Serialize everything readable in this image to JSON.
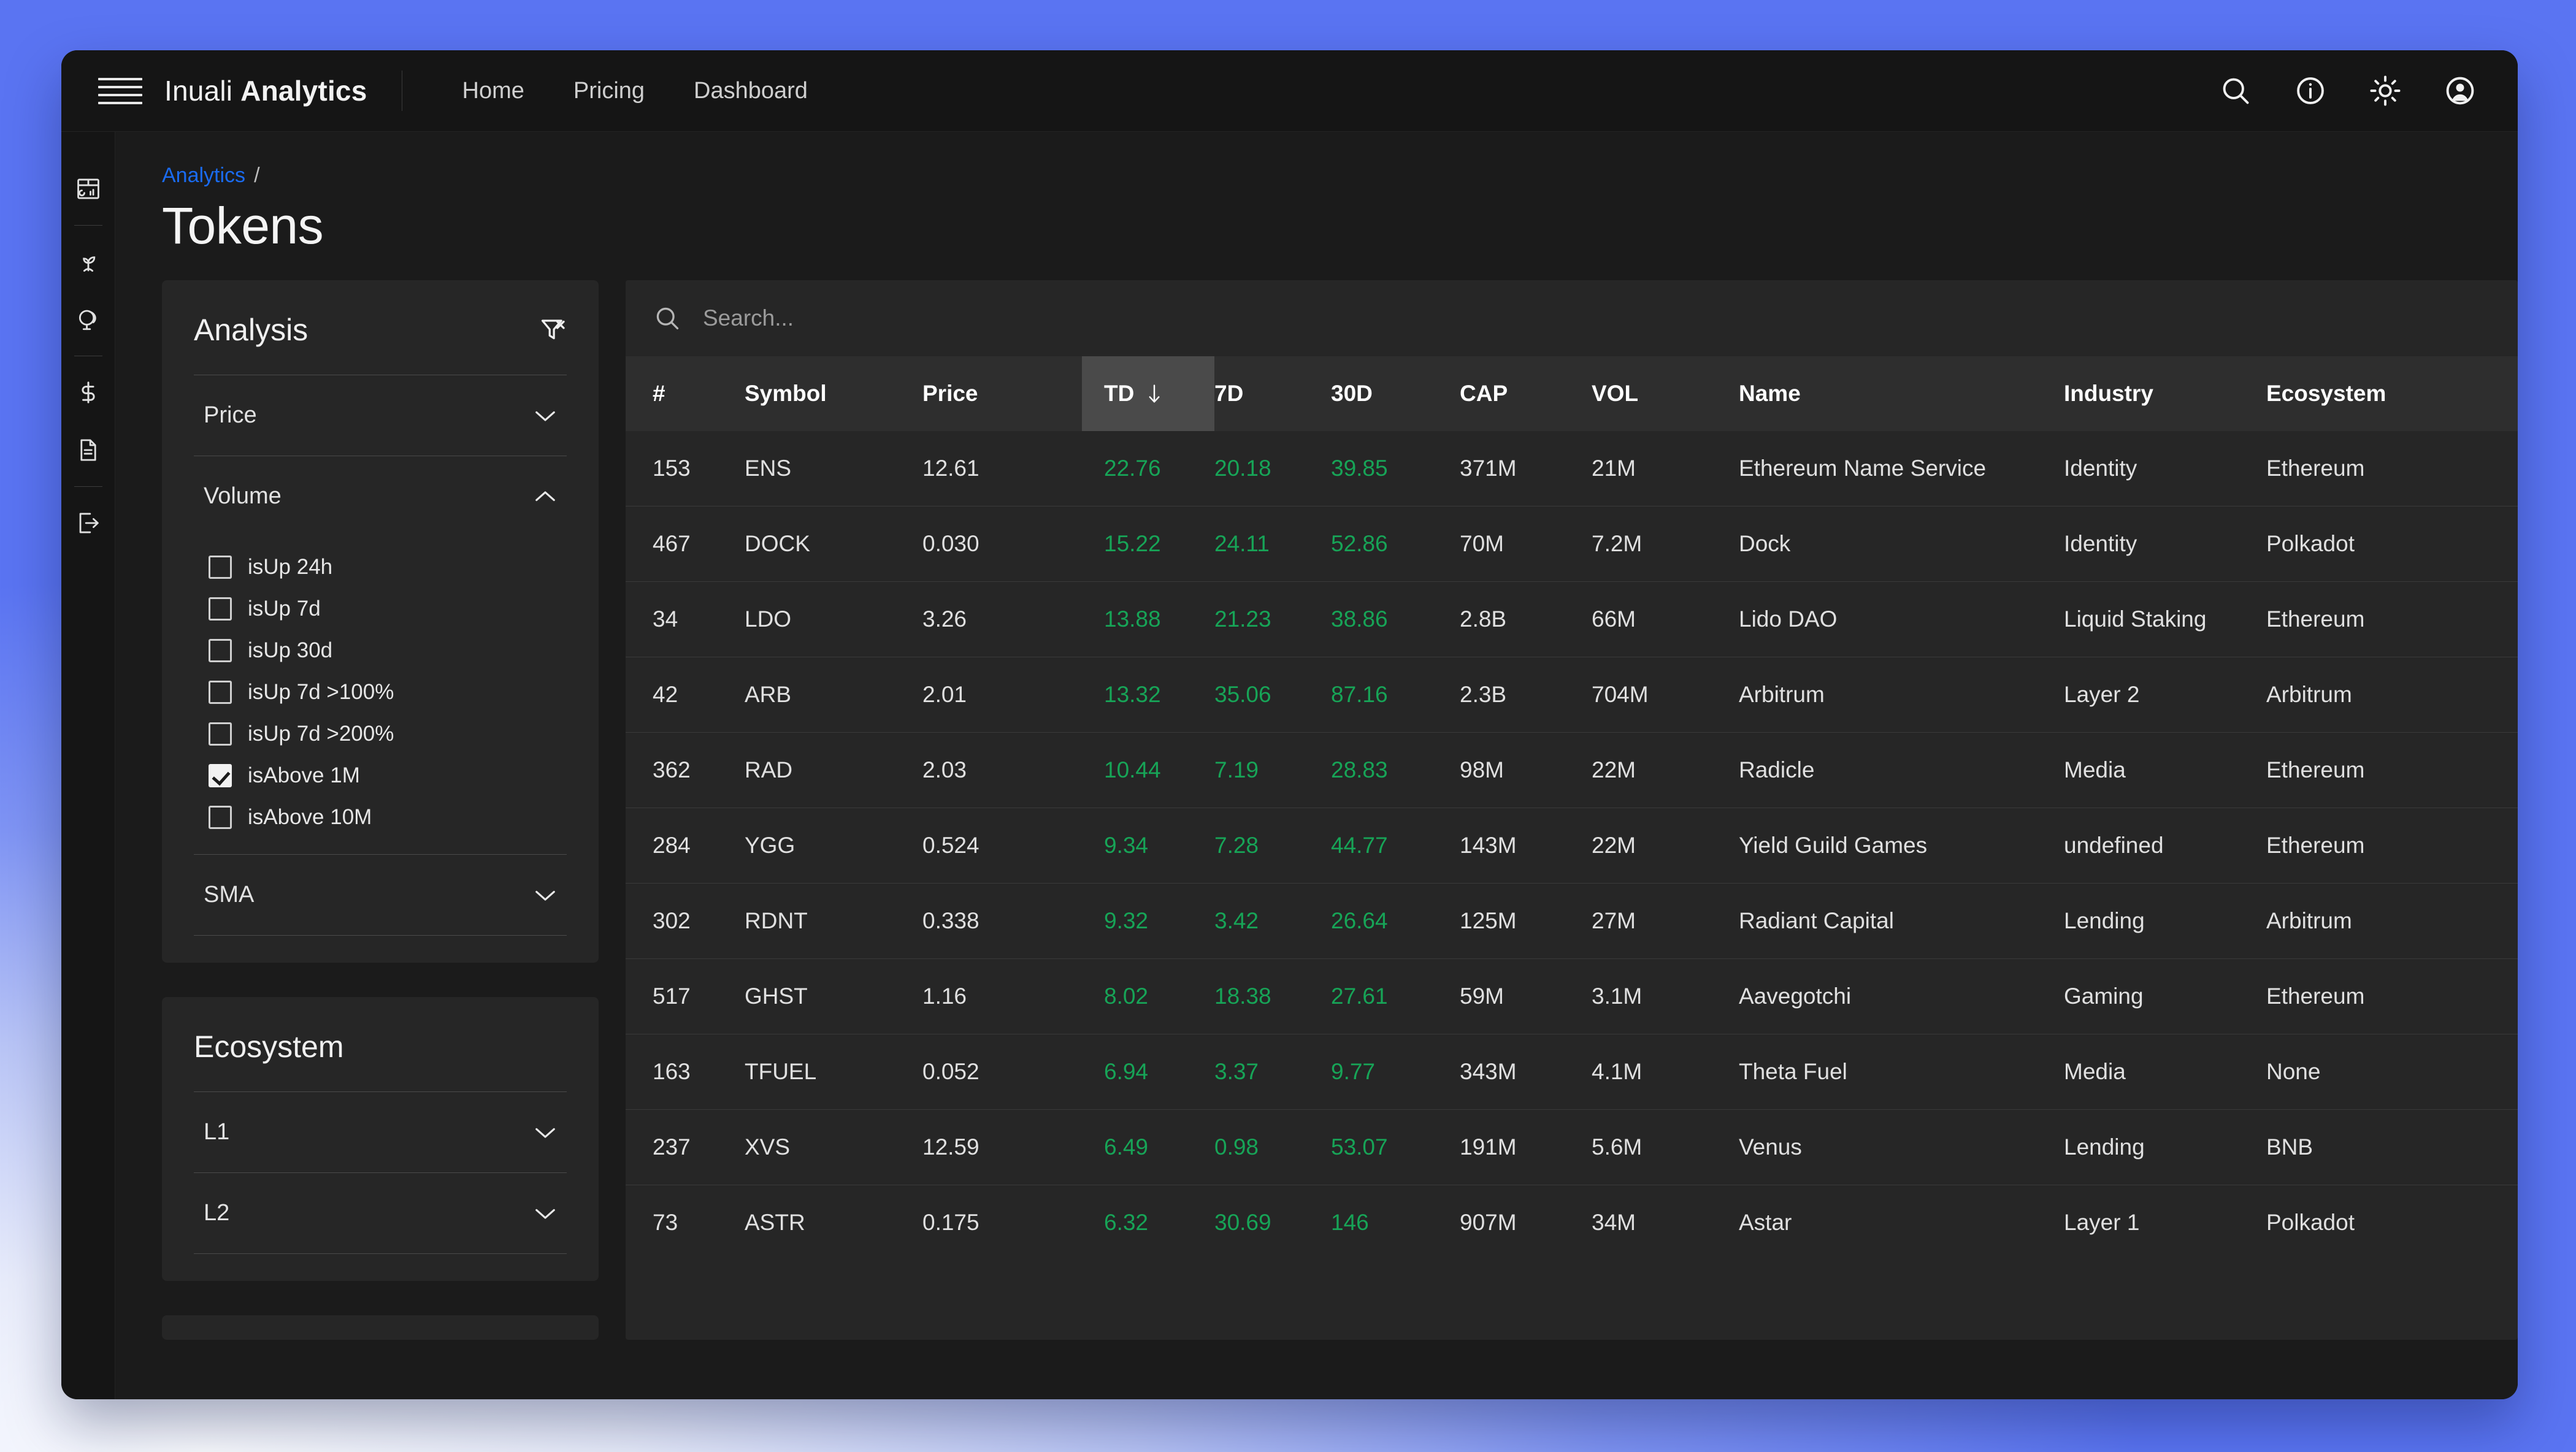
{
  "app": {
    "brand_prefix": "Inuali ",
    "brand_bold": "Analytics"
  },
  "nav": {
    "items": [
      {
        "label": "Home"
      },
      {
        "label": "Pricing"
      },
      {
        "label": "Dashboard"
      }
    ]
  },
  "topbar_icons": [
    {
      "name": "search-icon"
    },
    {
      "name": "info-icon"
    },
    {
      "name": "brightness-icon"
    },
    {
      "name": "account-icon"
    }
  ],
  "rail": {
    "items": [
      {
        "name": "dashboard-icon"
      },
      {
        "name": "sprout-icon"
      },
      {
        "name": "globe-icon"
      },
      {
        "name": "dollar-icon"
      },
      {
        "name": "document-icon"
      },
      {
        "name": "logout-icon"
      }
    ]
  },
  "breadcrumb": {
    "parent": "Analytics",
    "separator": "/"
  },
  "page": {
    "title": "Tokens"
  },
  "analysis_panel": {
    "title": "Analysis",
    "clear_filter_icon": "filter-off-icon",
    "sections": [
      {
        "label": "Price",
        "expanded": false
      },
      {
        "label": "Volume",
        "expanded": true
      },
      {
        "label": "SMA",
        "expanded": false
      }
    ],
    "volume_options": [
      {
        "label": "isUp 24h",
        "checked": false
      },
      {
        "label": "isUp 7d",
        "checked": false
      },
      {
        "label": "isUp 30d",
        "checked": false
      },
      {
        "label": "isUp 7d >100%",
        "checked": false
      },
      {
        "label": "isUp 7d >200%",
        "checked": false
      },
      {
        "label": "isAbove 1M",
        "checked": true
      },
      {
        "label": "isAbove 10M",
        "checked": false
      }
    ]
  },
  "ecosystem_panel": {
    "title": "Ecosystem",
    "sections": [
      {
        "label": "L1",
        "expanded": false
      },
      {
        "label": "L2",
        "expanded": false
      }
    ]
  },
  "search": {
    "placeholder": "Search...",
    "value": "",
    "icon": "search-icon"
  },
  "table": {
    "sort_column": "TD",
    "sort_direction": "desc",
    "columns": [
      {
        "key": "rank",
        "label": "#",
        "cls": "c-rank",
        "sorted": false
      },
      {
        "key": "symbol",
        "label": "Symbol",
        "cls": "c-symbol",
        "sorted": false
      },
      {
        "key": "price",
        "label": "Price",
        "cls": "c-price",
        "sorted": false
      },
      {
        "key": "td",
        "label": "TD",
        "cls": "c-td",
        "sorted": true
      },
      {
        "key": "d7",
        "label": "7D",
        "cls": "c-7d",
        "sorted": false
      },
      {
        "key": "d30",
        "label": "30D",
        "cls": "c-30d",
        "sorted": false
      },
      {
        "key": "cap",
        "label": "CAP",
        "cls": "c-cap",
        "sorted": false
      },
      {
        "key": "vol",
        "label": "VOL",
        "cls": "c-vol",
        "sorted": false
      },
      {
        "key": "name",
        "label": "Name",
        "cls": "c-name",
        "sorted": false
      },
      {
        "key": "industry",
        "label": "Industry",
        "cls": "c-ind",
        "sorted": false
      },
      {
        "key": "ecosystem",
        "label": "Ecosystem",
        "cls": "c-eco",
        "sorted": false
      }
    ],
    "rows": [
      {
        "rank": "153",
        "symbol": "ENS",
        "price": "12.61",
        "td": "22.76",
        "d7": "20.18",
        "d30": "39.85",
        "cap": "371M",
        "vol": "21M",
        "name": "Ethereum Name Service",
        "industry": "Identity",
        "ecosystem": "Ethereum"
      },
      {
        "rank": "467",
        "symbol": "DOCK",
        "price": "0.030",
        "td": "15.22",
        "d7": "24.11",
        "d30": "52.86",
        "cap": "70M",
        "vol": "7.2M",
        "name": "Dock",
        "industry": "Identity",
        "ecosystem": "Polkadot"
      },
      {
        "rank": "34",
        "symbol": "LDO",
        "price": "3.26",
        "td": "13.88",
        "d7": "21.23",
        "d30": "38.86",
        "cap": "2.8B",
        "vol": "66M",
        "name": "Lido DAO",
        "industry": "Liquid Staking",
        "ecosystem": "Ethereum"
      },
      {
        "rank": "42",
        "symbol": "ARB",
        "price": "2.01",
        "td": "13.32",
        "d7": "35.06",
        "d30": "87.16",
        "cap": "2.3B",
        "vol": "704M",
        "name": "Arbitrum",
        "industry": "Layer 2",
        "ecosystem": "Arbitrum"
      },
      {
        "rank": "362",
        "symbol": "RAD",
        "price": "2.03",
        "td": "10.44",
        "d7": "7.19",
        "d30": "28.83",
        "cap": "98M",
        "vol": "22M",
        "name": "Radicle",
        "industry": "Media",
        "ecosystem": "Ethereum"
      },
      {
        "rank": "284",
        "symbol": "YGG",
        "price": "0.524",
        "td": "9.34",
        "d7": "7.28",
        "d30": "44.77",
        "cap": "143M",
        "vol": "22M",
        "name": "Yield Guild Games",
        "industry": "undefined",
        "ecosystem": "Ethereum"
      },
      {
        "rank": "302",
        "symbol": "RDNT",
        "price": "0.338",
        "td": "9.32",
        "d7": "3.42",
        "d30": "26.64",
        "cap": "125M",
        "vol": "27M",
        "name": "Radiant Capital",
        "industry": "Lending",
        "ecosystem": "Arbitrum"
      },
      {
        "rank": "517",
        "symbol": "GHST",
        "price": "1.16",
        "td": "8.02",
        "d7": "18.38",
        "d30": "27.61",
        "cap": "59M",
        "vol": "3.1M",
        "name": "Aavegotchi",
        "industry": "Gaming",
        "ecosystem": "Ethereum"
      },
      {
        "rank": "163",
        "symbol": "TFUEL",
        "price": "0.052",
        "td": "6.94",
        "d7": "3.37",
        "d30": "9.77",
        "cap": "343M",
        "vol": "4.1M",
        "name": "Theta Fuel",
        "industry": "Media",
        "ecosystem": "None"
      },
      {
        "rank": "237",
        "symbol": "XVS",
        "price": "12.59",
        "td": "6.49",
        "d7": "0.98",
        "d30": "53.07",
        "cap": "191M",
        "vol": "5.6M",
        "name": "Venus",
        "industry": "Lending",
        "ecosystem": "BNB"
      },
      {
        "rank": "73",
        "symbol": "ASTR",
        "price": "0.175",
        "td": "6.32",
        "d7": "30.69",
        "d30": "146",
        "cap": "907M",
        "vol": "34M",
        "name": "Astar",
        "industry": "Layer 1",
        "ecosystem": "Polkadot"
      }
    ],
    "positive_columns": [
      "td",
      "d7",
      "d30"
    ]
  },
  "colors": {
    "positive": "#17a457",
    "link": "#1a6bf0",
    "panel": "#262626",
    "header_row": "#2e2e2e",
    "sorted_header": "#4a4a4a",
    "window": "#151515",
    "content": "#1b1b1b"
  }
}
